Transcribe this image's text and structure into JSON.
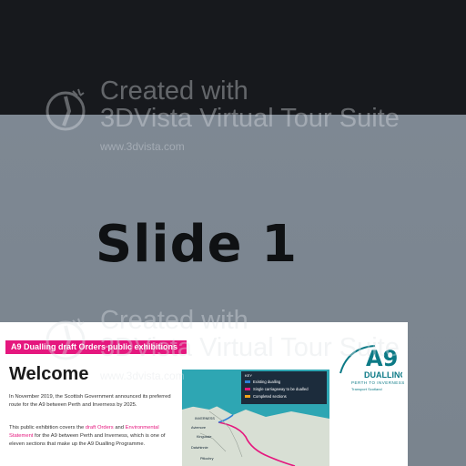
{
  "slide": {
    "title": "Slide 1"
  },
  "panel": {
    "banner": "A9 Dualling draft Orders public exhibitions",
    "welcome": "Welcome",
    "para1": "In November 2019, the Scottish Government announced its preferred route for the A9 between Perth and Inverness by 2025.",
    "para2_pre": "This public exhibition covers the ",
    "para2_hl1": "draft Orders",
    "para2_mid": " and ",
    "para2_hl2": "Environmental Statement",
    "para2_post": " for the A9 between Perth and Inverness, which is one of eleven sections that make up the A9 Dualling Programme.",
    "logo": {
      "letters": "A9",
      "word": "DUALLING",
      "sub1": "PERTH TO INVERNESS",
      "sub2": "Transport Scotland"
    },
    "map": {
      "legend_title": "KEY",
      "legend": [
        {
          "label": "Existing dualling",
          "color": "#2f7fd6"
        },
        {
          "label": "Single carriageway to be dualled",
          "color": "#e5177e"
        },
        {
          "label": "Completed sections",
          "color": "#f2a21a"
        }
      ],
      "labels": [
        "INVERNESS",
        "Aviemore",
        "Kingussie",
        "Dalwhinnie",
        "Pitlochry"
      ]
    }
  },
  "watermark": {
    "line1": "Created with",
    "line2": "3DVista Virtual Tour Suite",
    "url": "www.3dvista.com"
  },
  "colors": {
    "top_band": "#17191d",
    "background": "#7d8791",
    "accent_pink": "#e5177e",
    "brand_teal": "#0c7a86",
    "map_water": "#2ea6b3"
  }
}
